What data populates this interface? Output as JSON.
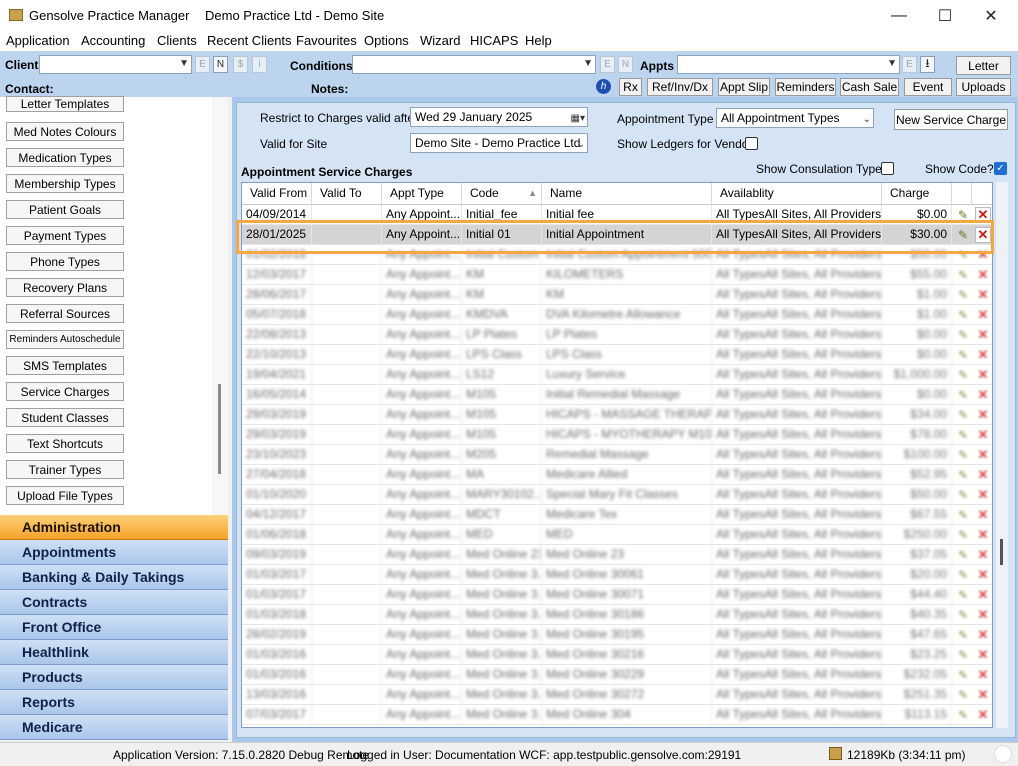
{
  "window": {
    "app_title": "Gensolve Practice Manager",
    "doc_title": "Demo Practice Ltd - Demo Site",
    "minimize": "—",
    "maximize": "☐",
    "close": "✕"
  },
  "menu": [
    "Application",
    "Accounting",
    "Clients",
    "Recent Clients",
    "Favourites",
    "Options",
    "Wizard",
    "HICAPS",
    "Help"
  ],
  "toolbar": {
    "client_label": "Client",
    "contact_label": "Contact:",
    "conditions_label": "Conditions",
    "notes_label": "Notes:",
    "appts_label": "Appts",
    "small_e": "E",
    "small_n": "N",
    "small_dollar": "$",
    "small_i": "i",
    "download_glyph": "⭳",
    "help_glyph": "h",
    "letter": "Letter",
    "buttons": [
      "Rx",
      "Ref/Inv/Dx",
      "Appt Slip",
      "Reminders",
      "Cash Sale",
      "Event",
      "Uploads"
    ]
  },
  "settings_list": [
    "Letter Templates",
    "Med Notes Colours",
    "Medication Types",
    "Membership Types",
    "Patient Goals",
    "Payment Types",
    "Phone Types",
    "Recovery Plans",
    "Referral Sources",
    "Reminders Autoschedule",
    "SMS Templates",
    "Service Charges",
    "Student Classes",
    "Text Shortcuts",
    "Trainer Types",
    "Upload File Types"
  ],
  "nav": {
    "active": "Administration",
    "items": [
      "Administration",
      "Appointments",
      "Banking & Daily Takings",
      "Contracts",
      "Front Office",
      "Healthlink",
      "Products",
      "Reports",
      "Medicare"
    ]
  },
  "filters": {
    "restrict_label": "Restrict to Charges valid after",
    "date_value": "Wed 29   January   2025",
    "appt_type_label": "Appointment Type",
    "appt_type_value": "All Appointment Types",
    "new_service_charge": "New Service Charge",
    "valid_for_site_label": "Valid for Site",
    "site_value": "Demo Site - Demo Practice Ltd",
    "show_ledgers_label": "Show Ledgers for Vendor",
    "show_consulation_label": "Show Consulation Type?",
    "show_code_label": "Show Code?",
    "section_title": "Appointment Service Charges"
  },
  "grid": {
    "columns": [
      "Valid From",
      "Valid To",
      "Appt Type",
      "Code",
      "Name",
      "Availablity",
      "Charge"
    ],
    "sort_glyph": "▲",
    "edit_glyph": "✎",
    "delete_glyph": "✕",
    "rows": [
      {
        "from": "04/09/2014",
        "to": "",
        "type": "Any Appoint...",
        "code": "Initial_fee",
        "name": "Initial fee",
        "avail": "All TypesAll Sites, All Providers",
        "charge": "$0.00"
      },
      {
        "from": "28/01/2025",
        "to": "",
        "type": "Any Appoint...",
        "code": "Initial 01",
        "name": "Initial Appointment",
        "avail": "All TypesAll Sites, All Providers",
        "charge": "$30.00",
        "selected": true
      },
      {
        "from": "01/02/2018",
        "to": "",
        "type": "Any Appoint...",
        "code": "Initial Custom",
        "name": "Initial Custom Appointment 500",
        "avail": "All TypesAll Sites, All Providers",
        "charge": "$50.00",
        "blurred": true
      },
      {
        "from": "12/03/2017",
        "to": "",
        "type": "Any Appoint...",
        "code": "KM",
        "name": "KILOMETERS",
        "avail": "All TypesAll Sites, All Providers",
        "charge": "$55.00",
        "blurred": true
      },
      {
        "from": "28/06/2017",
        "to": "",
        "type": "Any Appoint...",
        "code": "KM",
        "name": "KM",
        "avail": "All TypesAll Sites, All Providers",
        "charge": "$1.00",
        "blurred": true
      },
      {
        "from": "05/07/2018",
        "to": "",
        "type": "Any Appoint...",
        "code": "KMDVA",
        "name": "DVA Kilometre Allowance",
        "avail": "All TypesAll Sites, All Providers",
        "charge": "$1.00",
        "blurred": true
      },
      {
        "from": "22/08/2013",
        "to": "",
        "type": "Any Appoint...",
        "code": "LP Plates",
        "name": "LP Plates",
        "avail": "All TypesAll Sites, All Providers",
        "charge": "$0.00",
        "blurred": true
      },
      {
        "from": "22/10/2013",
        "to": "",
        "type": "Any Appoint...",
        "code": "LPS Class",
        "name": "LPS Class",
        "avail": "All TypesAll Sites, All Providers",
        "charge": "$0.00",
        "blurred": true
      },
      {
        "from": "19/04/2021",
        "to": "",
        "type": "Any Appoint...",
        "code": "LS12",
        "name": "Luxury Service",
        "avail": "All TypesAll Sites, All Providers",
        "charge": "$1,000.00",
        "blurred": true
      },
      {
        "from": "16/05/2014",
        "to": "",
        "type": "Any Appoint...",
        "code": "M105",
        "name": "Initial Remedial Massage",
        "avail": "All TypesAll Sites, All Providers",
        "charge": "$0.00",
        "blurred": true
      },
      {
        "from": "29/03/2019",
        "to": "",
        "type": "Any Appoint...",
        "code": "M105",
        "name": "HICAPS - MASSAGE THERAP...",
        "avail": "All TypesAll Sites, All Providers",
        "charge": "$34.00",
        "blurred": true
      },
      {
        "from": "29/03/2019",
        "to": "",
        "type": "Any Appoint...",
        "code": "M105",
        "name": "HICAPS - MYOTHERAPY M105...",
        "avail": "All TypesAll Sites, All Providers",
        "charge": "$78.00",
        "blurred": true
      },
      {
        "from": "23/10/2023",
        "to": "",
        "type": "Any Appoint...",
        "code": "M205",
        "name": "Remedial Massage",
        "avail": "All TypesAll Sites, All Providers",
        "charge": "$100.00",
        "blurred": true
      },
      {
        "from": "27/04/2018",
        "to": "",
        "type": "Any Appoint...",
        "code": "MA",
        "name": "Medicare Allied",
        "avail": "All TypesAll Sites, All Providers",
        "charge": "$52.95",
        "blurred": true
      },
      {
        "from": "01/10/2020",
        "to": "",
        "type": "Any Appoint...",
        "code": "MARY30102...",
        "name": "Special Mary Fit Classes",
        "avail": "All TypesAll Sites, All Providers",
        "charge": "$50.00",
        "blurred": true
      },
      {
        "from": "04/12/2017",
        "to": "",
        "type": "Any Appoint...",
        "code": "MDCT",
        "name": "Medicare Tex",
        "avail": "All TypesAll Sites, All Providers",
        "charge": "$67.55",
        "blurred": true
      },
      {
        "from": "01/06/2018",
        "to": "",
        "type": "Any Appoint...",
        "code": "MED",
        "name": "MED",
        "avail": "All TypesAll Sites, All Providers",
        "charge": "$250.00",
        "blurred": true
      },
      {
        "from": "09/03/2019",
        "to": "",
        "type": "Any Appoint...",
        "code": "Med Online 23",
        "name": "Med Online 23",
        "avail": "All TypesAll Sites, All Providers",
        "charge": "$37.05",
        "blurred": true
      },
      {
        "from": "01/03/2017",
        "to": "",
        "type": "Any Appoint...",
        "code": "Med Online 3...",
        "name": "Med Online 30061",
        "avail": "All TypesAll Sites, All Providers",
        "charge": "$20.00",
        "blurred": true
      },
      {
        "from": "01/03/2017",
        "to": "",
        "type": "Any Appoint...",
        "code": "Med Online 3...",
        "name": "Med Online 30071",
        "avail": "All TypesAll Sites, All Providers",
        "charge": "$44.40",
        "blurred": true
      },
      {
        "from": "01/03/2018",
        "to": "",
        "type": "Any Appoint...",
        "code": "Med Online 3...",
        "name": "Med Online 30186",
        "avail": "All TypesAll Sites, All Providers",
        "charge": "$40.35",
        "blurred": true
      },
      {
        "from": "28/02/2019",
        "to": "",
        "type": "Any Appoint...",
        "code": "Med Online 3...",
        "name": "Med Online 30195",
        "avail": "All TypesAll Sites, All Providers",
        "charge": "$47.65",
        "blurred": true
      },
      {
        "from": "01/03/2016",
        "to": "",
        "type": "Any Appoint...",
        "code": "Med Online 3...",
        "name": "Med Online 30216",
        "avail": "All TypesAll Sites, All Providers",
        "charge": "$23.25",
        "blurred": true
      },
      {
        "from": "01/03/2016",
        "to": "",
        "type": "Any Appoint...",
        "code": "Med Online 3...",
        "name": "Med Online 30229",
        "avail": "All TypesAll Sites, All Providers",
        "charge": "$232.05",
        "blurred": true
      },
      {
        "from": "13/03/2016",
        "to": "",
        "type": "Any Appoint...",
        "code": "Med Online 3...",
        "name": "Med Online 30272",
        "avail": "All TypesAll Sites, All Providers",
        "charge": "$251.35",
        "blurred": true
      },
      {
        "from": "07/03/2017",
        "to": "",
        "type": "Any Appoint...",
        "code": "Med Online 3...",
        "name": "Med Online 304",
        "avail": "All TypesAll Sites, All Providers",
        "charge": "$113.15",
        "blurred": true
      }
    ]
  },
  "status": {
    "version": "Application Version: 7.15.0.2820 Debug Remote",
    "user": "Logged in User: Documentation WCF: app.testpublic.gensolve.com:29191",
    "memory": "12189Kb (3:34:11 pm)"
  }
}
